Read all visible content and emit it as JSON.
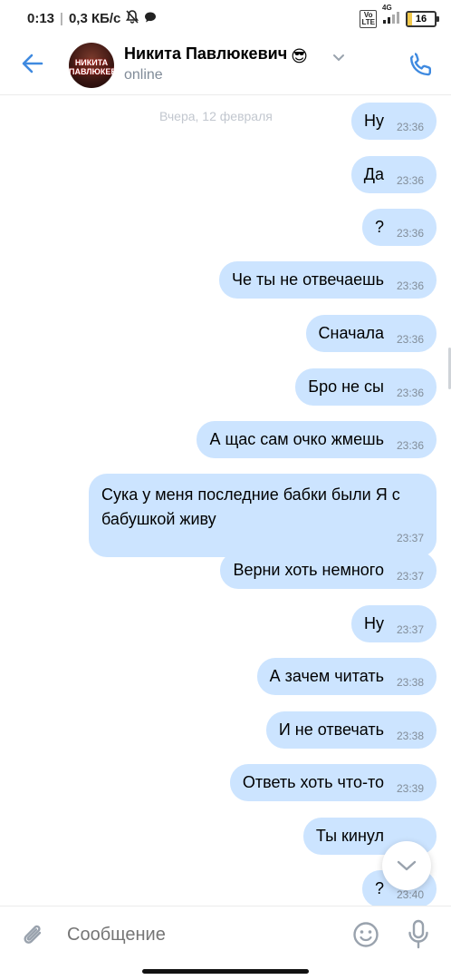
{
  "status_bar": {
    "time": "0:13",
    "speed": "0,3 КБ/с",
    "network": "4G",
    "volte": "Vo LTE",
    "battery": "16"
  },
  "header": {
    "contact_name": "Никита Павлюкевич",
    "emoji": "😎",
    "status": "online",
    "avatar_text": "НИКИТА ПАВЛЮКЕВИ"
  },
  "date_separator": "Вчера, 12 февраля",
  "messages": [
    {
      "text": "Ну",
      "time": "23:36"
    },
    {
      "text": "Да",
      "time": "23:36"
    },
    {
      "text": "?",
      "time": "23:36"
    },
    {
      "text": "Че ты не отвечаешь",
      "time": "23:36"
    },
    {
      "text": "Сначала",
      "time": "23:36"
    },
    {
      "text": "Бро не сы",
      "time": "23:36"
    },
    {
      "text": "А щас сам очко жмешь",
      "time": "23:36"
    },
    {
      "text": "Сука у меня последние бабки были Я с бабушкой живу",
      "time": "23:37"
    },
    {
      "text": "Верни хоть немного",
      "time": "23:37"
    },
    {
      "text": "Ну",
      "time": "23:37"
    },
    {
      "text": "А зачем читать",
      "time": "23:38"
    },
    {
      "text": "И не отвечать",
      "time": "23:38"
    },
    {
      "text": "Ответь хоть что-то",
      "time": "23:39"
    },
    {
      "text": "Ты кинул",
      "time": ""
    },
    {
      "text": "?",
      "time": "23:40"
    }
  ],
  "composer": {
    "placeholder": "Сообщение"
  },
  "colors": {
    "accent": "#2a5885",
    "bubble_outgoing": "#cce4ff",
    "icon_blue": "#3f8ae0"
  }
}
